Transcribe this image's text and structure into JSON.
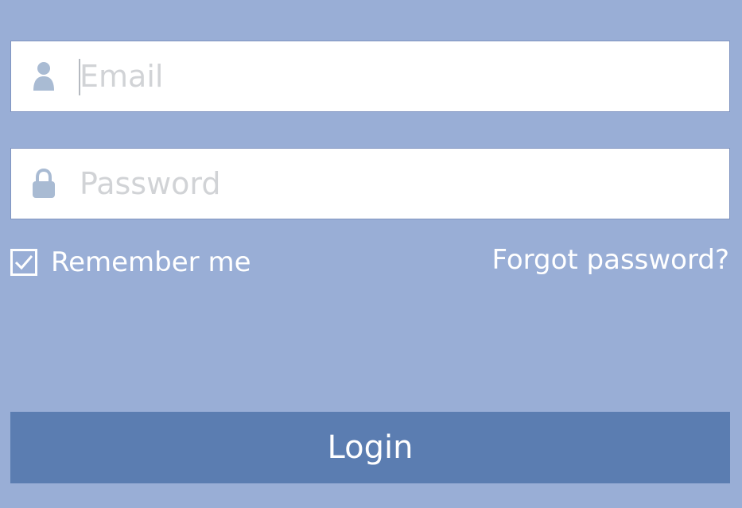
{
  "colors": {
    "background": "#99aed6",
    "field_background": "#ffffff",
    "icon_color": "#a9bbd3",
    "placeholder_color": "#d1d3d6",
    "login_button": "#5b7db1",
    "text_on_background": "#ffffff"
  },
  "email": {
    "icon": "user-icon",
    "placeholder": "Email",
    "value": ""
  },
  "password": {
    "icon": "lock-icon",
    "placeholder": "Password",
    "value": ""
  },
  "remember": {
    "label": "Remember me",
    "checked": true
  },
  "forgot_password": {
    "label": "Forgot password?"
  },
  "login": {
    "label": "Login"
  }
}
